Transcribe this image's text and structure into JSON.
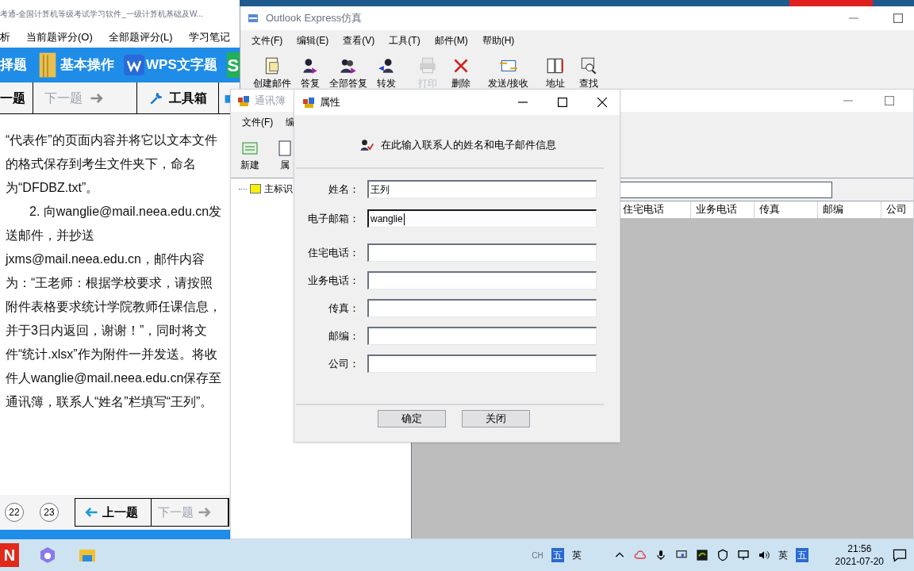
{
  "exam_window": {
    "title": "考通-全国计算机等级考试学习软件_一级计算机基础及W...",
    "menu": [
      "析",
      "当前题评分(O)",
      "全部题评分(L)",
      "学习笔记"
    ],
    "categories": [
      {
        "label": "择题"
      },
      {
        "label": "基本操作"
      },
      {
        "label": "WPS文字题"
      },
      {
        "label": "S"
      }
    ],
    "nav": [
      {
        "label": "一题",
        "disabled": false
      },
      {
        "label": "下一题",
        "disabled": true
      },
      {
        "label": "工具箱",
        "disabled": false
      }
    ],
    "question_paragraphs": [
      "“代表作”的页面内容并将它以文本文件的格式保存到考生文件夹下，命名为“DFDBZ.txt”。",
      "2. 向wanglie@mail.neea.edu.cn发送邮件，并抄送jxms@mail.neea.edu.cn，邮件内容为：“王老师：根据学校要求，请按照附件表格要求统计学院教师任课信息，并于3日内返回，谢谢！”，同时将文件“统计.xlsx”作为附件一并发送。将收件人wanglie@mail.neea.edu.cn保存至通讯簿，联系人“姓名”栏填写“王列”。"
    ],
    "pages": [
      "22",
      "23"
    ],
    "bottom_nav": [
      {
        "label": "上一题",
        "disabled": false
      },
      {
        "label": "下一题",
        "disabled": true
      }
    ]
  },
  "outlook": {
    "title": "Outlook Express仿真",
    "menu": [
      "文件(F)",
      "编辑(E)",
      "查看(V)",
      "工具(T)",
      "邮件(M)",
      "帮助(H)"
    ],
    "toolbar": [
      {
        "label": "创建邮件",
        "disabled": false
      },
      {
        "label": "答复",
        "disabled": false
      },
      {
        "label": "全部答复",
        "disabled": false
      },
      {
        "label": "转发",
        "disabled": false
      },
      {
        "label": "打印",
        "disabled": true
      },
      {
        "label": "删除",
        "disabled": false
      },
      {
        "label": "发送/接收",
        "disabled": false
      },
      {
        "label": "地址",
        "disabled": false
      },
      {
        "label": "查找",
        "disabled": false
      }
    ]
  },
  "address_book": {
    "title": "通讯簿",
    "menu": [
      "文件(F)",
      "编"
    ],
    "toolbar": [
      "新建",
      "属"
    ],
    "tree": [
      "主标识"
    ],
    "columns": [
      "住宅电话",
      "业务电话",
      "传真",
      "邮编",
      "公司"
    ]
  },
  "dialog": {
    "title": "属性",
    "header": "在此输入联系人的姓名和电子邮件信息",
    "fields": [
      {
        "label": "姓名：",
        "value": "王列",
        "focused": false
      },
      {
        "label": "电子邮箱：",
        "value": "wanglie",
        "focused": true
      },
      {
        "label": "住宅电话：",
        "focused": false
      },
      {
        "label": "业务电话：",
        "focused": false
      },
      {
        "label": "传真：",
        "focused": false
      },
      {
        "label": "邮编：",
        "focused": false
      },
      {
        "label": "公司：",
        "focused": false
      }
    ],
    "buttons": [
      "确定",
      "关闭"
    ]
  },
  "taskbar": {
    "app_letter": "N",
    "ime": [
      "CH",
      "五",
      "英"
    ],
    "tray_ime": [
      "英",
      "五"
    ],
    "time": "21:56",
    "date": "2021-07-20"
  }
}
